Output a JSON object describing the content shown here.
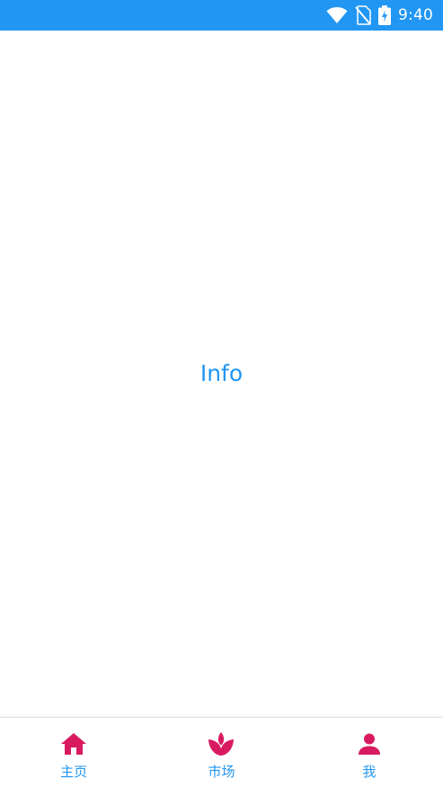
{
  "status_bar": {
    "time": "9:40",
    "background": "#2196f3",
    "icons": [
      "wifi-icon",
      "no-sim-icon",
      "battery-charging-icon"
    ]
  },
  "main": {
    "text": "Info",
    "text_color": "#2196f3"
  },
  "bottom_nav": {
    "icon_color": "#d81b60",
    "label_color": "#2196f3",
    "items": [
      {
        "label": "主页",
        "icon": "home-icon"
      },
      {
        "label": "市场",
        "icon": "lotus-icon"
      },
      {
        "label": "我",
        "icon": "person-icon"
      }
    ]
  }
}
